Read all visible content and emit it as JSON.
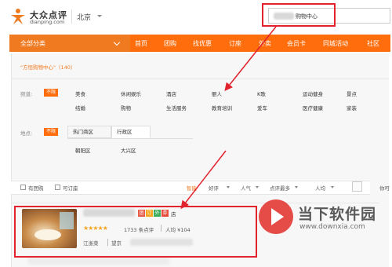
{
  "header": {
    "logo_cn": "大众点评",
    "logo_en": "dianping.com",
    "city": "北京",
    "search_text": "购物中心"
  },
  "nav": {
    "all_categories": "全部分类",
    "items": [
      "首页",
      "团购",
      "找优惠",
      "订座",
      "外卖",
      "会员卡",
      "同城活动",
      "社区"
    ]
  },
  "breadcrumb": "\"方恒购物中心\"（140）",
  "filters": {
    "category_label": "频道:",
    "unlimited": "不限",
    "categories_row1": [
      "美食",
      "休闲娱乐",
      "酒店",
      "丽人",
      "K歌",
      "运动健身",
      "景点"
    ],
    "categories_row2": [
      "结婚",
      "购物",
      "生活服务",
      "教育培训",
      "爱车",
      "医疗健康",
      "家装"
    ],
    "location_label": "地点:",
    "location_tabs": [
      "热门商区",
      "行政区"
    ],
    "districts": [
      "朝阳区",
      "大兴区"
    ]
  },
  "toolbar": {
    "checkbox_tuan": "有团购",
    "checkbox_reserve": "可订座",
    "sort_smart": "智能",
    "sort_rating": "好评",
    "sort_popularity": "人气",
    "sort_reviews": "点评最多",
    "sort_avg": "人均",
    "side_text": "你可"
  },
  "result": {
    "tags": [
      "团",
      "订",
      "外",
      "券"
    ],
    "tag_colors": [
      "#e85d4a",
      "#f5a623",
      "#3cae5b",
      "#e74c3c"
    ],
    "tag_suffix": "店",
    "stars": "★★★★★",
    "reviews": "1733 条点评",
    "avg_price": "人均 ¥104",
    "location": "江浙菜",
    "location2": "望京"
  },
  "watermark": {
    "cn": "当下软件园",
    "en": "www.downxia.com"
  },
  "colors": {
    "accent": "#ff6d0d",
    "annotation": "#e2222c"
  }
}
